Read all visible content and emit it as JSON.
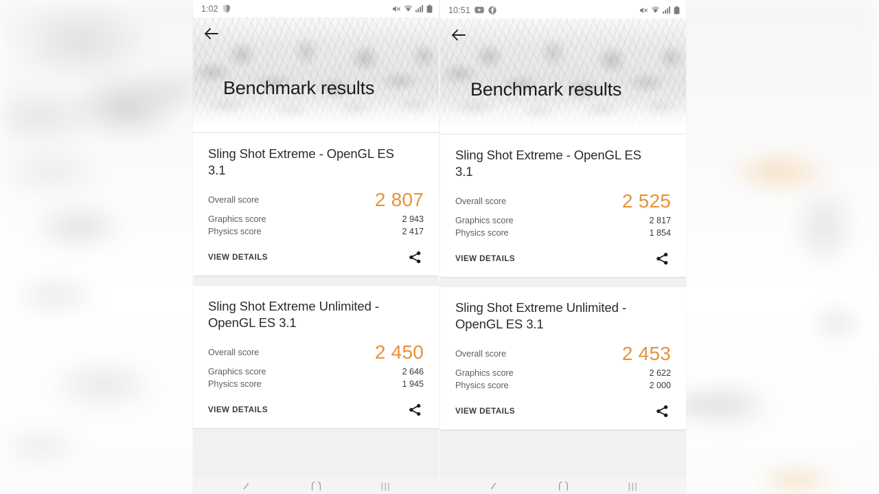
{
  "meta": {
    "accent_orange": "#e8913a",
    "card_bg": "#ffffff",
    "list_bg": "#f1f1f1"
  },
  "phones": [
    {
      "id": "left",
      "status": {
        "time": "1:02",
        "left_icons": [
          "dnd-shield-icon"
        ],
        "right_icons": [
          "mute-icon",
          "wifi-icon",
          "signal-icon",
          "battery-icon"
        ]
      },
      "header": {
        "back_label": "Back",
        "title": "Benchmark results"
      },
      "cards": [
        {
          "title": "Sling Shot Extreme - OpenGL ES 3.1",
          "overall_label": "Overall score",
          "overall_value": "2 807",
          "rows": [
            {
              "label": "Graphics score",
              "value": "2 943"
            },
            {
              "label": "Physics score",
              "value": "2 417"
            }
          ],
          "view_details": "VIEW DETAILS",
          "share_icon": "share-icon"
        },
        {
          "title": "Sling Shot Extreme Unlimited - OpenGL ES 3.1",
          "overall_label": "Overall score",
          "overall_value": "2 450",
          "rows": [
            {
              "label": "Graphics score",
              "value": "2 646"
            },
            {
              "label": "Physics score",
              "value": "1 945"
            }
          ],
          "view_details": "VIEW DETAILS",
          "share_icon": "share-icon"
        }
      ],
      "navbar": [
        "back-nav-icon",
        "home-nav-icon",
        "recents-nav-icon"
      ],
      "recents_glyph": "|||"
    },
    {
      "id": "right",
      "status": {
        "time": "10:51",
        "left_icons": [
          "youtube-icon",
          "facebook-icon"
        ],
        "right_icons": [
          "mute-icon",
          "wifi-icon",
          "signal-icon",
          "battery-icon"
        ]
      },
      "header": {
        "back_label": "Back",
        "title": "Benchmark results"
      },
      "cards": [
        {
          "title": "Sling Shot Extreme - OpenGL ES 3.1",
          "overall_label": "Overall score",
          "overall_value": "2 525",
          "rows": [
            {
              "label": "Graphics score",
              "value": "2 817"
            },
            {
              "label": "Physics score",
              "value": "1 854"
            }
          ],
          "view_details": "VIEW DETAILS",
          "share_icon": "share-icon"
        },
        {
          "title": "Sling Shot Extreme Unlimited - OpenGL ES 3.1",
          "overall_label": "Overall score",
          "overall_value": "2 453",
          "rows": [
            {
              "label": "Graphics score",
              "value": "2 622"
            },
            {
              "label": "Physics score",
              "value": "2 000"
            }
          ],
          "view_details": "VIEW DETAILS",
          "share_icon": "share-icon"
        }
      ],
      "navbar": [
        "back-nav-icon",
        "home-nav-icon",
        "recents-nav-icon"
      ],
      "recents_glyph": "|||"
    }
  ]
}
